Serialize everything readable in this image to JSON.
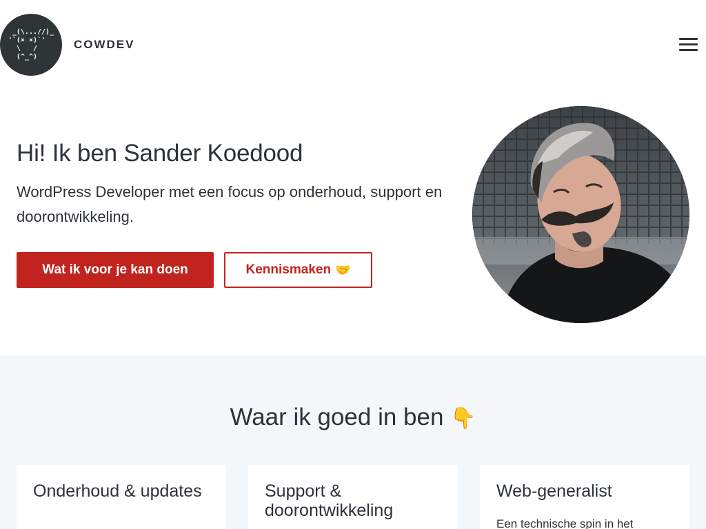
{
  "header": {
    "logo_art": " _(\\...//)_\n'`(× ×)`'\n  \\   /\n  (^_^)",
    "brand": "COWDEV"
  },
  "hero": {
    "title": "Hi! Ik ben Sander Koedood",
    "subtitle": "WordPress Developer met een focus op onderhoud, support en doorontwikkeling.",
    "primary_button": "Wat ik voor je kan doen",
    "secondary_button": "Kennismaken",
    "secondary_button_emoji": "🤝"
  },
  "skills": {
    "title": "Waar ik goed in ben",
    "title_emoji": "👇",
    "cards": [
      {
        "title": "Onderhoud & updates",
        "text": ""
      },
      {
        "title": "Support & doorontwikkeling",
        "text": ""
      },
      {
        "title": "Web-generalist",
        "text": "Een technische spin in het"
      }
    ]
  },
  "colors": {
    "accent": "#c1241f",
    "text": "#2d3239",
    "section_bg": "#f4f7fa",
    "logo_bg": "#2f3437"
  },
  "icons": {
    "menu": "hamburger-icon"
  }
}
